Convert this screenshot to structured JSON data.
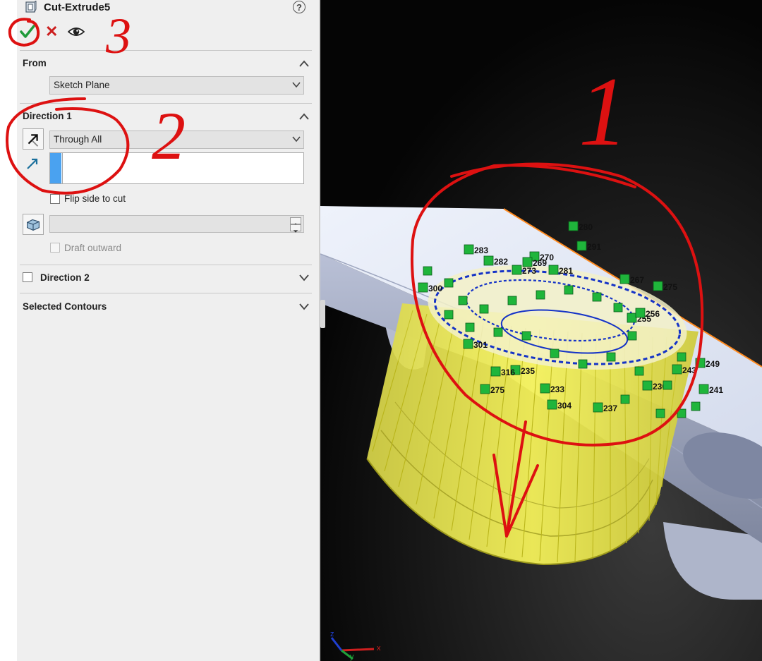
{
  "feature": {
    "title": "Cut-Extrude5"
  },
  "help": {
    "label": "?"
  },
  "actions": {
    "cancel_glyph": "✕"
  },
  "from": {
    "header": "From",
    "start_condition": "Sketch Plane"
  },
  "direction1": {
    "header": "Direction 1",
    "end_condition": "Through All",
    "flip_side_label": "Flip side to cut",
    "draft_outward_label": "Draft outward"
  },
  "direction2": {
    "header": "Direction 2"
  },
  "selected_contours": {
    "header": "Selected Contours"
  },
  "annotations": {
    "one": "1",
    "two": "2",
    "three": "3"
  },
  "sketch_labels": [
    "280",
    "291",
    "283",
    "270",
    "269",
    "273",
    "282",
    "281",
    "267",
    "275",
    "255",
    "256",
    "249",
    "243",
    "241",
    "237",
    "235",
    "275",
    "316",
    "301",
    "300",
    "304",
    "233",
    "230"
  ],
  "triad": {
    "x": "x",
    "y": "y",
    "z": "z"
  },
  "colors": {
    "panel_bg": "#efefef",
    "accent_blue": "#4aa2f0",
    "ok_green": "#1f9a3a",
    "cancel_red": "#cc1f1f",
    "cut_yellow": "#f5f24a",
    "sketch_green": "#1fb53b",
    "sketch_blue": "#1533c7",
    "annotation_red": "#dd1111"
  },
  "icons": {
    "feature": "cut-extrude-icon",
    "ok": "checkmark-icon",
    "cancel": "close-icon",
    "preview": "eye-icon",
    "reverse": "reverse-direction-icon",
    "direction_vector": "direction-arrow-icon",
    "draft": "draft-icon"
  }
}
